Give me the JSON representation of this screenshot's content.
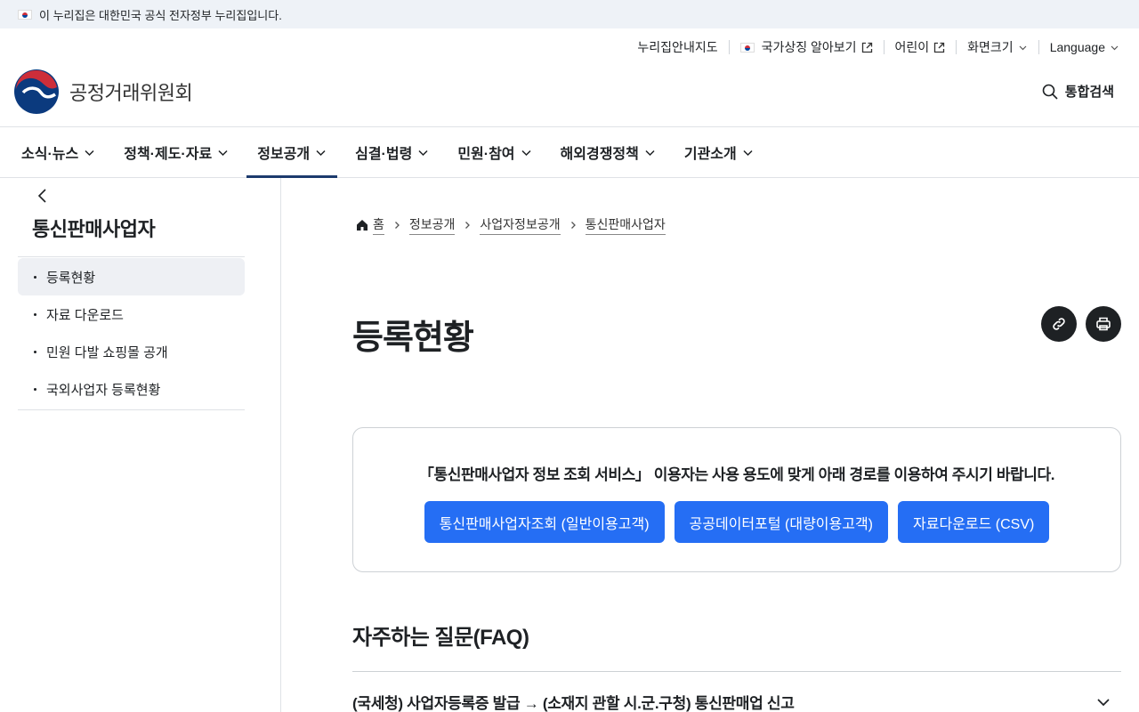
{
  "gov_banner": {
    "text": "이 누리집은 대한민국 공식 전자정부 누리집입니다."
  },
  "utility": {
    "sitemap": "누리집안내지도",
    "national_symbols": "국가상징 알아보기",
    "kids": "어린이",
    "font_size": "화면크기",
    "language": "Language"
  },
  "header": {
    "org_name": "공정거래위원회",
    "search": "통합검색"
  },
  "gnb": {
    "items": [
      {
        "label": "소식·뉴스"
      },
      {
        "label": "정책·제도·자료"
      },
      {
        "label": "정보공개"
      },
      {
        "label": "심결·법령"
      },
      {
        "label": "민원·참여"
      },
      {
        "label": "해외경쟁정책"
      },
      {
        "label": "기관소개"
      }
    ],
    "active_index": 2
  },
  "side": {
    "title": "통신판매사업자",
    "items": [
      {
        "label": "등록현황"
      },
      {
        "label": "자료 다운로드"
      },
      {
        "label": "민원 다발 쇼핑몰 공개"
      },
      {
        "label": "국외사업자 등록현황"
      }
    ]
  },
  "breadcrumb": {
    "home": "홈",
    "items": [
      "정보공개",
      "사업자정보공개",
      "통신판매사업자"
    ]
  },
  "main": {
    "title": "등록현황",
    "notice": "「통신판매사업자 정보 조회 서비스」 이용자는 사용 용도에 맞게 아래 경로를 이용하여 주시기 바랍니다.",
    "buttons": [
      {
        "label": "통신판매사업자조회 (일반이용고객)"
      },
      {
        "label": "공공데이터포털 (대량이용고객)"
      },
      {
        "label": "자료다운로드 (CSV)"
      }
    ],
    "faq_title": "자주하는 질문(FAQ)",
    "faq_first": "(국세청) 사업자등록증 발급 → (소재지 관할 시.군.구청) 통신판매업 신고"
  },
  "colors": {
    "primary": "#256ef4",
    "navy": "#1c3a6d",
    "dark": "#1e2124"
  }
}
